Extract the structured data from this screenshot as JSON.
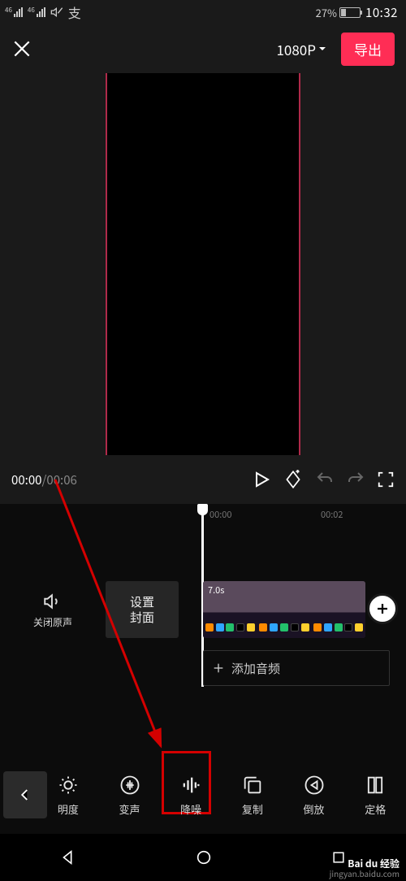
{
  "status": {
    "net_label": "46",
    "battery_percent": "27%",
    "time": "10:32"
  },
  "header": {
    "resolution": "1080P",
    "export_label": "导出"
  },
  "playback": {
    "current": "00:00",
    "duration": "00:06"
  },
  "timeline": {
    "marks": [
      "00:00",
      "00:02"
    ],
    "mute_original_label": "关闭原声",
    "cover_label": "设置\n封面",
    "clip_duration": "7.0s",
    "add_audio_label": "添加音频"
  },
  "tools": [
    {
      "id": "brightness",
      "label": "明度"
    },
    {
      "id": "voice-change",
      "label": "变声"
    },
    {
      "id": "noise-reduce",
      "label": "降噪"
    },
    {
      "id": "copy",
      "label": "复制"
    },
    {
      "id": "reverse",
      "label": "倒放"
    },
    {
      "id": "freeze",
      "label": "定格"
    }
  ],
  "watermark": {
    "brand": "Bai du 经验",
    "url": "jingyan.baidu.com"
  }
}
